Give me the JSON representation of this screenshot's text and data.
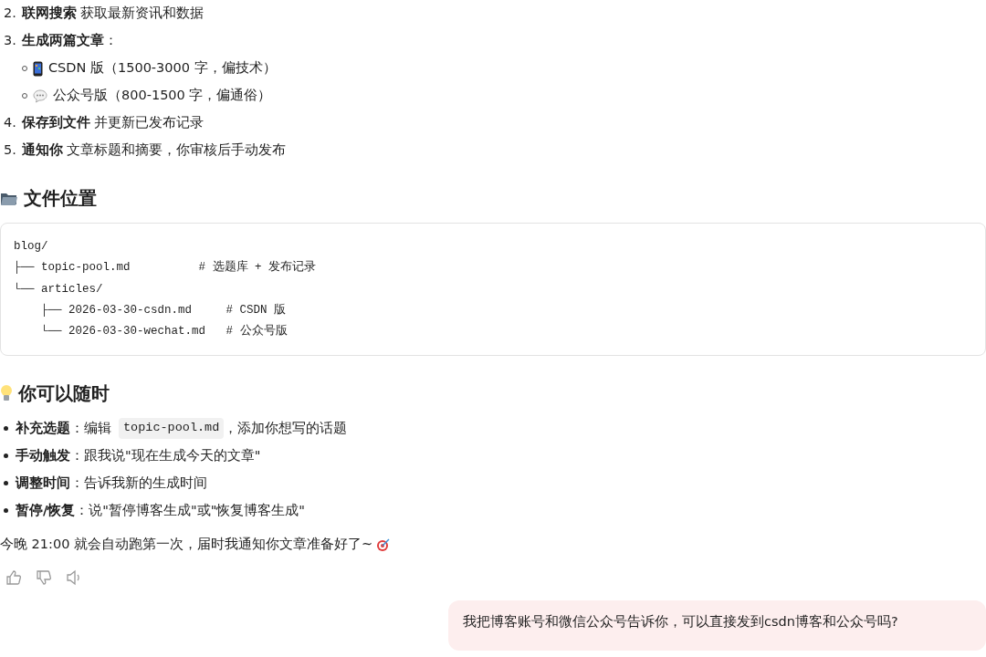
{
  "steps": [
    {
      "number": "2.",
      "text": "**联网搜索** 获取最新资讯和数据"
    },
    {
      "number": "3.",
      "text": "**生成两篇文章**：",
      "children": [
        {
          "text": "CSDN 版（1500-3000 字，偏技术）"
        },
        {
          "text": "公众号版（800-1500 字，偏通俗）"
        }
      ]
    },
    {
      "number": "4.",
      "text": "**保存到文件** 并更新已发布记录"
    },
    {
      "number": "5.",
      "text": "**通知你** 文章标题和摘要，你审核后手动发布"
    }
  ],
  "file_section": {
    "heading": "文件位置",
    "code_lines": [
      "blog/",
      "├── topic-pool.md          # 选题库 + 发布记录",
      "└── articles/",
      "    ├── 2026-03-30-csdn.md     # CSDN 版",
      "    └── 2026-03-30-wechat.md   # 公众号版"
    ]
  },
  "tips_section": {
    "heading": "你可以随时",
    "items": [
      {
        "text": "**补充选题**：编辑",
        "code": "topic-pool.md",
        "after": "，添加你想写的话题"
      },
      {
        "text": "**手动触发**：跟我说\"现在生成今天的文章\""
      },
      {
        "text": "**调整时间**：告诉我新的生成时间"
      },
      {
        "text": "**暂停/恢复**：说\"暂停博客生成\"或\"恢复博客生成\""
      }
    ]
  },
  "closing": "今晚 21:00 就会自动跑第一次，届时我通知你文章准备好了~",
  "user_message": "我把博客账号和微信公众号告诉你，可以直接发到csdn博客和公众号吗?"
}
